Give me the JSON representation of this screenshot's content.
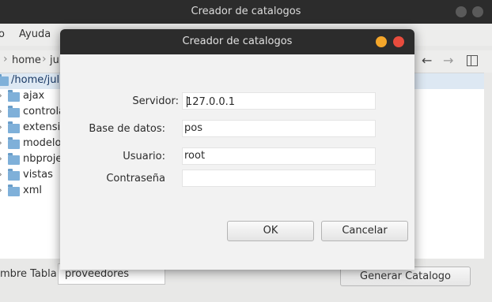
{
  "main_window": {
    "title": "Creador de catalogos",
    "menu": [
      "o",
      "Ayuda"
    ],
    "breadcrumbs": [
      "home",
      "juli"
    ],
    "tree": {
      "root": "/home/julio",
      "folders": [
        "ajax",
        "controla",
        "extensio",
        "modelo",
        "nbproje",
        "vistas",
        "xml"
      ]
    },
    "table_label": "mbre Tabla:",
    "table_value": "proveedores",
    "generate_button": "Generar Catalogo"
  },
  "dialog": {
    "title": "Creador de catalogos",
    "fields": [
      {
        "label": "Servidor:",
        "value": "127.0.0.1"
      },
      {
        "label": "Base de datos:",
        "value": "pos"
      },
      {
        "label": "Usuario:",
        "value": "root"
      },
      {
        "label": "Contraseña",
        "value": ""
      }
    ],
    "ok_label": "OK",
    "cancel_label": "Cancelar"
  },
  "colors": {
    "titlebar": "#2c2c2c",
    "minimize": "#f4a62a",
    "close": "#e84c3d",
    "selection": "#dde8f3"
  }
}
